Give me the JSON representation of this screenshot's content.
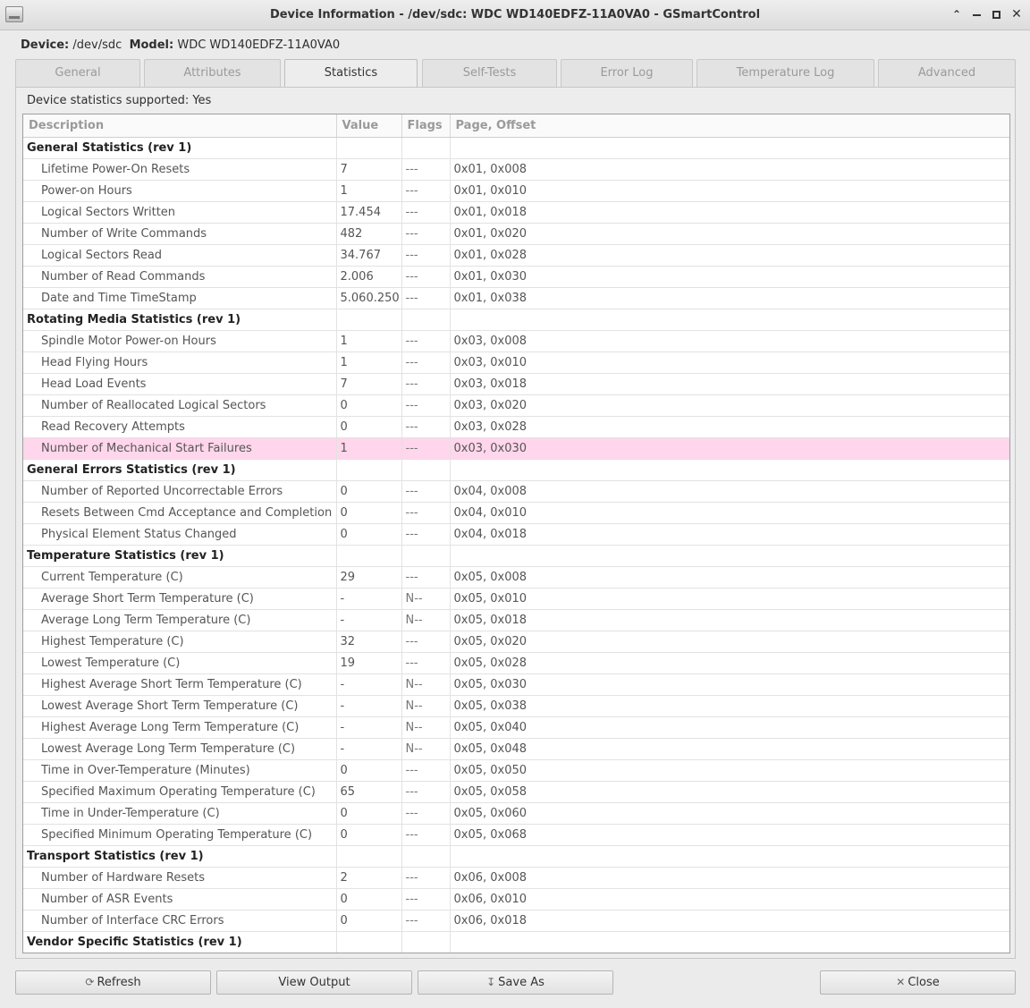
{
  "window": {
    "title": "Device Information - /dev/sdc: WDC WD140EDFZ-11A0VA0 - GSmartControl"
  },
  "device": {
    "device_label": "Device:",
    "device_value": "/dev/sdc",
    "model_label": "Model:",
    "model_value": "WDC WD140EDFZ-11A0VA0"
  },
  "tabs": [
    {
      "label": "General"
    },
    {
      "label": "Attributes"
    },
    {
      "label": "Statistics"
    },
    {
      "label": "Self-Tests"
    },
    {
      "label": "Error Log"
    },
    {
      "label": "Temperature Log"
    },
    {
      "label": "Advanced"
    }
  ],
  "statistics": {
    "supported_text": "Device statistics supported: Yes",
    "columns": [
      "Description",
      "Value",
      "Flags",
      "Page, Offset"
    ],
    "rows": [
      {
        "header": true,
        "desc": "General Statistics (rev 1)",
        "value": "",
        "flags": "",
        "page": ""
      },
      {
        "desc": "Lifetime Power-On Resets",
        "value": "7",
        "flags": "---",
        "page": "0x01, 0x008"
      },
      {
        "desc": "Power-on Hours",
        "value": "1",
        "flags": "---",
        "page": "0x01, 0x010"
      },
      {
        "desc": "Logical Sectors Written",
        "value": "17.454",
        "flags": "---",
        "page": "0x01, 0x018"
      },
      {
        "desc": "Number of Write Commands",
        "value": "482",
        "flags": "---",
        "page": "0x01, 0x020"
      },
      {
        "desc": "Logical Sectors Read",
        "value": "34.767",
        "flags": "---",
        "page": "0x01, 0x028"
      },
      {
        "desc": "Number of Read Commands",
        "value": "2.006",
        "flags": "---",
        "page": "0x01, 0x030"
      },
      {
        "desc": "Date and Time TimeStamp",
        "value": "5.060.250",
        "flags": "---",
        "page": "0x01, 0x038"
      },
      {
        "header": true,
        "desc": "Rotating Media Statistics (rev 1)",
        "value": "",
        "flags": "",
        "page": ""
      },
      {
        "desc": "Spindle Motor Power-on Hours",
        "value": "1",
        "flags": "---",
        "page": "0x03, 0x008"
      },
      {
        "desc": "Head Flying Hours",
        "value": "1",
        "flags": "---",
        "page": "0x03, 0x010"
      },
      {
        "desc": "Head Load Events",
        "value": "7",
        "flags": "---",
        "page": "0x03, 0x018"
      },
      {
        "desc": "Number of Reallocated Logical Sectors",
        "value": "0",
        "flags": "---",
        "page": "0x03, 0x020"
      },
      {
        "desc": "Read Recovery Attempts",
        "value": "0",
        "flags": "---",
        "page": "0x03, 0x028"
      },
      {
        "desc": "Number of Mechanical Start Failures",
        "value": "1",
        "flags": "---",
        "page": "0x03, 0x030",
        "highlight": true
      },
      {
        "header": true,
        "desc": "General Errors Statistics (rev 1)",
        "value": "",
        "flags": "",
        "page": ""
      },
      {
        "desc": "Number of Reported Uncorrectable Errors",
        "value": "0",
        "flags": "---",
        "page": "0x04, 0x008"
      },
      {
        "desc": "Resets Between Cmd Acceptance and Completion",
        "value": "0",
        "flags": "---",
        "page": "0x04, 0x010"
      },
      {
        "desc": "Physical Element Status Changed",
        "value": "0",
        "flags": "---",
        "page": "0x04, 0x018"
      },
      {
        "header": true,
        "desc": "Temperature Statistics (rev 1)",
        "value": "",
        "flags": "",
        "page": ""
      },
      {
        "desc": "Current Temperature (C)",
        "value": "29",
        "flags": "---",
        "page": "0x05, 0x008"
      },
      {
        "desc": "Average Short Term Temperature (C)",
        "value": "-",
        "flags": "N--",
        "page": "0x05, 0x010"
      },
      {
        "desc": "Average Long Term Temperature (C)",
        "value": "-",
        "flags": "N--",
        "page": "0x05, 0x018"
      },
      {
        "desc": "Highest Temperature (C)",
        "value": "32",
        "flags": "---",
        "page": "0x05, 0x020"
      },
      {
        "desc": "Lowest Temperature (C)",
        "value": "19",
        "flags": "---",
        "page": "0x05, 0x028"
      },
      {
        "desc": "Highest Average Short Term Temperature (C)",
        "value": "-",
        "flags": "N--",
        "page": "0x05, 0x030"
      },
      {
        "desc": "Lowest Average Short Term Temperature (C)",
        "value": "-",
        "flags": "N--",
        "page": "0x05, 0x038"
      },
      {
        "desc": "Highest Average Long Term Temperature (C)",
        "value": "-",
        "flags": "N--",
        "page": "0x05, 0x040"
      },
      {
        "desc": "Lowest Average Long Term Temperature (C)",
        "value": "-",
        "flags": "N--",
        "page": "0x05, 0x048"
      },
      {
        "desc": "Time in Over-Temperature (Minutes)",
        "value": "0",
        "flags": "---",
        "page": "0x05, 0x050"
      },
      {
        "desc": "Specified Maximum Operating Temperature (C)",
        "value": "65",
        "flags": "---",
        "page": "0x05, 0x058"
      },
      {
        "desc": "Time in Under-Temperature (C)",
        "value": "0",
        "flags": "---",
        "page": "0x05, 0x060"
      },
      {
        "desc": "Specified Minimum Operating Temperature (C)",
        "value": "0",
        "flags": "---",
        "page": "0x05, 0x068"
      },
      {
        "header": true,
        "desc": "Transport Statistics (rev 1)",
        "value": "",
        "flags": "",
        "page": ""
      },
      {
        "desc": "Number of Hardware Resets",
        "value": "2",
        "flags": "---",
        "page": "0x06, 0x008"
      },
      {
        "desc": "Number of ASR Events",
        "value": "0",
        "flags": "---",
        "page": "0x06, 0x010"
      },
      {
        "desc": "Number of Interface CRC Errors",
        "value": "0",
        "flags": "---",
        "page": "0x06, 0x018"
      },
      {
        "header": true,
        "desc": "Vendor Specific Statistics (rev 1)",
        "value": "",
        "flags": "",
        "page": ""
      }
    ]
  },
  "buttons": {
    "refresh": "Refresh",
    "view_output": "View Output",
    "save_as": "Save As",
    "close": "Close"
  },
  "colors": {
    "highlight_row": "#ffd6ec"
  }
}
